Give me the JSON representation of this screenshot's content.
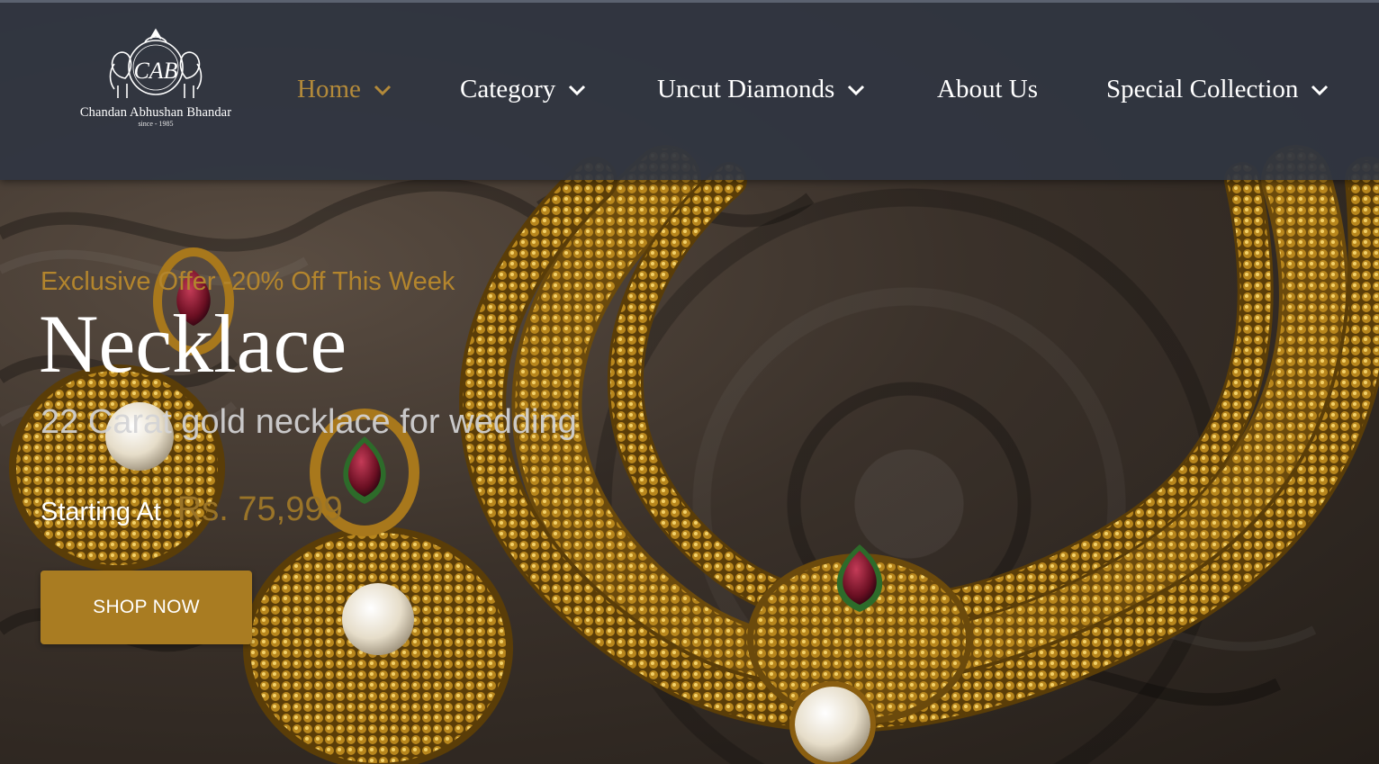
{
  "brand": {
    "name": "Chandan Abhushan Bhandar",
    "since": "since - 1985",
    "monogram": "CAB"
  },
  "nav": {
    "items": [
      {
        "label": "Home",
        "has_dropdown": true,
        "active": true
      },
      {
        "label": "Category",
        "has_dropdown": true,
        "active": false
      },
      {
        "label": "Uncut Diamonds",
        "has_dropdown": true,
        "active": false
      },
      {
        "label": "About Us",
        "has_dropdown": false,
        "active": false
      },
      {
        "label": "Special Collection",
        "has_dropdown": true,
        "active": false
      }
    ]
  },
  "hero": {
    "offer": "Exclusive Offer -20% Off This Week",
    "title": "Necklace",
    "subtitle": "22 Carat gold necklace for wedding",
    "starting_label": "Starting At",
    "price": "Rs. 75,999",
    "cta_label": "SHOP NOW"
  },
  "colors": {
    "header_bg": "#303642",
    "accent_gold": "#b3852d",
    "button_bg": "#a97c22",
    "text_white": "#ffffff"
  },
  "icons": {
    "dropdown": "chevron-down-icon",
    "logo": "elephant-emblem-icon"
  }
}
